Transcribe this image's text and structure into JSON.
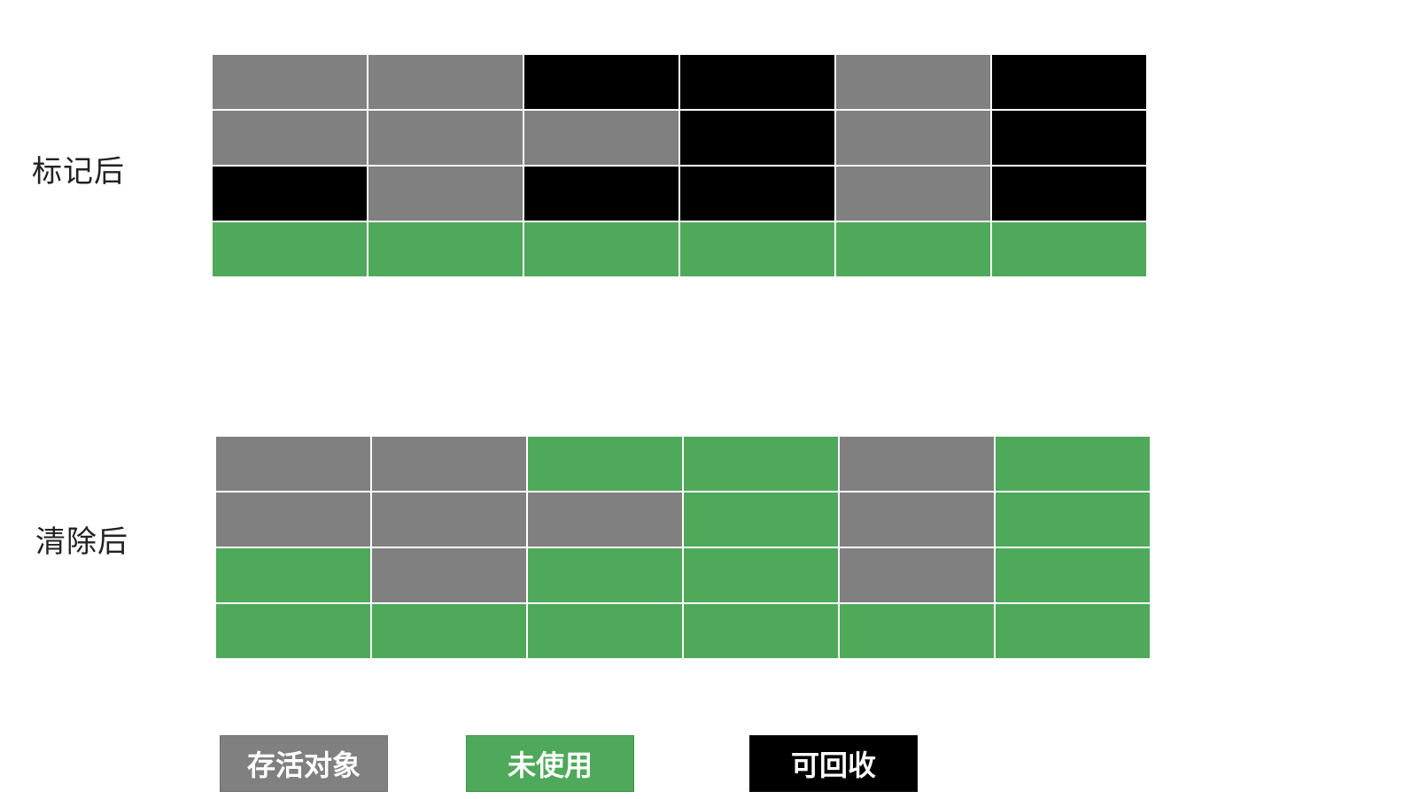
{
  "labels": {
    "marked": "标记后",
    "swept": "清除后"
  },
  "legend": {
    "live": "存活对象",
    "free": "未使用",
    "dead": "可回收"
  },
  "colors": {
    "live": "#808080",
    "free": "#4ea95a",
    "dead": "#000000"
  },
  "grids": {
    "marked": [
      [
        "live",
        "live",
        "dead",
        "dead",
        "live",
        "dead"
      ],
      [
        "live",
        "live",
        "live",
        "dead",
        "live",
        "dead"
      ],
      [
        "dead",
        "live",
        "dead",
        "dead",
        "live",
        "dead"
      ],
      [
        "free",
        "free",
        "free",
        "free",
        "free",
        "free"
      ]
    ],
    "swept": [
      [
        "live",
        "live",
        "free",
        "free",
        "live",
        "free"
      ],
      [
        "live",
        "live",
        "live",
        "free",
        "live",
        "free"
      ],
      [
        "free",
        "live",
        "free",
        "free",
        "live",
        "free"
      ],
      [
        "free",
        "free",
        "free",
        "free",
        "free",
        "free"
      ]
    ]
  }
}
